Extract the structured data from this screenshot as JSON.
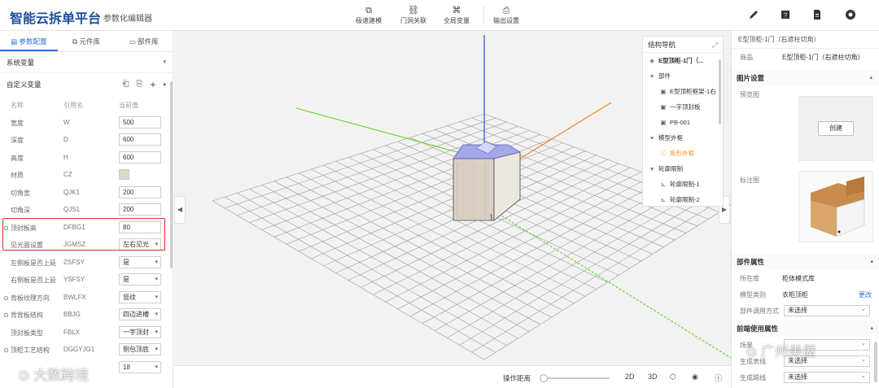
{
  "header": {
    "brand": "智能云拆单平台",
    "subtitle": "参数化编辑器",
    "tools": [
      {
        "label": "极速建模",
        "icon": "box-icon"
      },
      {
        "label": "门洞关联",
        "icon": "link-icon"
      },
      {
        "label": "全局变量",
        "icon": "global-icon"
      },
      {
        "label": "输出设置",
        "icon": "output-icon"
      }
    ],
    "right_tools": [
      "pen-icon",
      "help-icon",
      "document-icon",
      "settings-icon"
    ]
  },
  "left": {
    "tabs": [
      "参数配置",
      "元件库",
      "部件库"
    ],
    "system_vars": "系统变量",
    "custom_vars": "自定义变量",
    "columns": [
      "名称",
      "引用名",
      "当前值"
    ],
    "rows": [
      {
        "name": "宽度",
        "ref": "W",
        "value": "500"
      },
      {
        "name": "深度",
        "ref": "D",
        "value": "600"
      },
      {
        "name": "高度",
        "ref": "H",
        "value": "600"
      },
      {
        "name": "材质",
        "ref": "CZ",
        "value": ""
      },
      {
        "name": "切角宽",
        "ref": "QJK1",
        "value": "200"
      },
      {
        "name": "切角深",
        "ref": "QJS1",
        "value": "200"
      },
      {
        "name": "顶封板高",
        "ref": "DFBG1",
        "value": "80"
      },
      {
        "name": "见光面设置",
        "ref": "JGMSZ",
        "value": "左右见光"
      },
      {
        "name": "左侧板是否上延",
        "ref": "ZSFSY",
        "value": "是"
      },
      {
        "name": "右侧板是否上延",
        "ref": "YSFSY",
        "value": "是"
      },
      {
        "name": "背板纹理方向",
        "ref": "BWLFX",
        "value": "竖纹"
      },
      {
        "name": "背背板结构",
        "ref": "BBJG",
        "value": "四边进槽"
      },
      {
        "name": "顶封板类型",
        "ref": "FBLX",
        "value": "一字顶封"
      },
      {
        "name": "顶柜工艺结构",
        "ref": "DGGYJG1",
        "value": "侧包顶底"
      },
      {
        "name": "",
        "ref": "",
        "value": "18"
      },
      {
        "name": "",
        "ref": "",
        "value": ""
      }
    ]
  },
  "nav": {
    "title": "结构导航",
    "root": "E型顶柜-1门（...",
    "items": [
      {
        "label": "部件",
        "type": "group"
      },
      {
        "label": "E型顶柜框架-1右",
        "type": "leaf"
      },
      {
        "label": "一字顶封板",
        "type": "leaf"
      },
      {
        "label": "PB-001",
        "type": "leaf"
      },
      {
        "label": "模型外框",
        "type": "group"
      },
      {
        "label": "矩形外框",
        "type": "warn"
      },
      {
        "label": "轮廓限制",
        "type": "group"
      },
      {
        "label": "轮廓限制-1",
        "type": "leaf2"
      },
      {
        "label": "轮廓限制-2",
        "type": "leaf2"
      }
    ]
  },
  "bottom": {
    "distance_label": "操作距离",
    "buttons": [
      "2D",
      "3D"
    ]
  },
  "right": {
    "title": "E型顶柜-1门（右遮柱切角）",
    "product_key": "商品",
    "product_val": "E型顶柜-1门（右遮柱切角）",
    "image_section": "图片设置",
    "preview_key": "预览图",
    "create_btn": "创建",
    "annotation_key": "标注图",
    "part_section": "部件属性",
    "lib_key": "所在库",
    "lib_val": "柜体模式库",
    "model_key": "模型类别",
    "model_val": "衣柜顶柜",
    "model_link": "更改",
    "call_key": "部件调用方式",
    "call_val": "未选择",
    "front_section": "前端使用属性",
    "f1_key": "场景",
    "f1_val": "",
    "f2_key": "生成表线",
    "f2_val": "未选择",
    "f3_key": "生成踢线",
    "f3_val": "未选择"
  },
  "watermarks": {
    "left": "大数跨境",
    "right": "广州美屋"
  },
  "colors": {
    "brand": "#1d4e9b",
    "accent": "#2a6fd6",
    "highlight_box": "#e02a2a",
    "axis_x": "#f08a24",
    "axis_y": "#2b4fd8",
    "axis_z": "#5fd620",
    "warn": "#e8921a"
  }
}
